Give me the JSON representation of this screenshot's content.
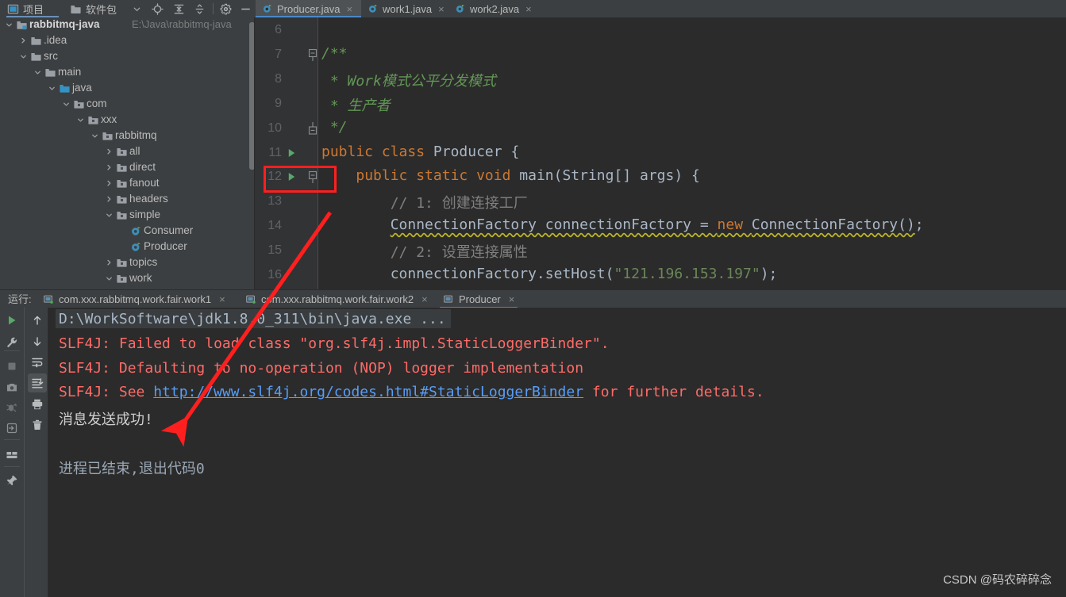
{
  "toolbar": {
    "project_label": "项目",
    "package_label": "软件包",
    "buttons": [
      "chevron-down-icon",
      "locate-target-icon",
      "expand-all-icon",
      "collapse-all-icon",
      "gear-icon",
      "minimize-icon"
    ]
  },
  "editor_tabs": [
    {
      "label": "Producer.java",
      "close": "×",
      "active": true
    },
    {
      "label": "work1.java",
      "close": "×",
      "active": false
    },
    {
      "label": "work2.java",
      "close": "×",
      "active": false
    }
  ],
  "project_tree": {
    "root_path": "E:\\Java\\rabbitmq-java",
    "rows": [
      {
        "label": "rabbitmq-java",
        "level": 0,
        "arrow": "down",
        "icon": "module",
        "bold": true
      },
      {
        "label": ".idea",
        "level": 1,
        "arrow": "right",
        "icon": "folder"
      },
      {
        "label": "src",
        "level": 1,
        "arrow": "down",
        "icon": "folder"
      },
      {
        "label": "main",
        "level": 2,
        "arrow": "down",
        "icon": "folder"
      },
      {
        "label": "java",
        "level": 3,
        "arrow": "down",
        "icon": "source-folder"
      },
      {
        "label": "com",
        "level": 4,
        "arrow": "down",
        "icon": "package"
      },
      {
        "label": "xxx",
        "level": 5,
        "arrow": "down",
        "icon": "package"
      },
      {
        "label": "rabbitmq",
        "level": 6,
        "arrow": "down",
        "icon": "package"
      },
      {
        "label": "all",
        "level": 7,
        "arrow": "right",
        "icon": "package"
      },
      {
        "label": "direct",
        "level": 7,
        "arrow": "right",
        "icon": "package"
      },
      {
        "label": "fanout",
        "level": 7,
        "arrow": "right",
        "icon": "package"
      },
      {
        "label": "headers",
        "level": 7,
        "arrow": "right",
        "icon": "package"
      },
      {
        "label": "simple",
        "level": 7,
        "arrow": "down",
        "icon": "package"
      },
      {
        "label": "Consumer",
        "level": 8,
        "arrow": "none",
        "icon": "java-class"
      },
      {
        "label": "Producer",
        "level": 8,
        "arrow": "none",
        "icon": "java-class"
      },
      {
        "label": "topics",
        "level": 7,
        "arrow": "right",
        "icon": "package"
      },
      {
        "label": "work",
        "level": 7,
        "arrow": "down",
        "icon": "package"
      }
    ]
  },
  "code": {
    "lines": [
      {
        "num": "6",
        "run": false,
        "fold": "none",
        "tokens": []
      },
      {
        "num": "7",
        "run": false,
        "fold": "start",
        "tokens": [
          {
            "t": "/**",
            "c": "j"
          }
        ]
      },
      {
        "num": "8",
        "run": false,
        "fold": "none",
        "tokens": [
          {
            "t": " * Work模式公平分发模式",
            "c": "j"
          }
        ]
      },
      {
        "num": "9",
        "run": false,
        "fold": "none",
        "tokens": [
          {
            "t": " * 生产者",
            "c": "j"
          }
        ]
      },
      {
        "num": "10",
        "run": false,
        "fold": "end",
        "tokens": [
          {
            "t": " */",
            "c": "j"
          }
        ]
      },
      {
        "num": "11",
        "run": true,
        "fold": "none",
        "tokens": [
          {
            "t": "public class ",
            "c": "k"
          },
          {
            "t": "Producer ",
            "c": "d"
          },
          {
            "t": "{",
            "c": "d"
          }
        ]
      },
      {
        "num": "12",
        "run": true,
        "fold": "mid",
        "tokens": [
          {
            "t": "    ",
            "c": "d"
          },
          {
            "t": "public static void ",
            "c": "k"
          },
          {
            "t": "main",
            "c": "d"
          },
          {
            "t": "(String[] args) {",
            "c": "d"
          }
        ]
      },
      {
        "num": "13",
        "run": false,
        "fold": "none",
        "tokens": [
          {
            "t": "        // 1: 创建连接工厂",
            "c": "c"
          }
        ]
      },
      {
        "num": "14",
        "run": false,
        "fold": "none",
        "tokens": [
          {
            "t": "        ",
            "c": "d"
          },
          {
            "t": "ConnectionFactory connectionFactory = ",
            "c": "d wavy"
          },
          {
            "t": "new ",
            "c": "k wavy"
          },
          {
            "t": "ConnectionFactory()",
            "c": "d wavy"
          },
          {
            "t": ";",
            "c": "d"
          }
        ]
      },
      {
        "num": "15",
        "run": false,
        "fold": "none",
        "tokens": [
          {
            "t": "        // 2: 设置连接属性",
            "c": "c"
          }
        ]
      },
      {
        "num": "16",
        "run": false,
        "fold": "none",
        "tokens": [
          {
            "t": "        connectionFactory.",
            "c": "d"
          },
          {
            "t": "setHost",
            "c": "d"
          },
          {
            "t": "(",
            "c": "d"
          },
          {
            "t": "\"121.196.153.197\"",
            "c": "s"
          },
          {
            "t": ");",
            "c": "d"
          }
        ]
      }
    ]
  },
  "run_panel": {
    "label": "运行:",
    "tabs": [
      {
        "label": "com.xxx.rabbitmq.work.fair.work1",
        "close": "×",
        "active": false
      },
      {
        "label": "com.xxx.rabbitmq.work.fair.work2",
        "close": "×",
        "active": false
      },
      {
        "label": "Producer",
        "close": "×",
        "active": true
      }
    ],
    "tools_left": [
      "rerun-icon",
      "settings-wrench-icon",
      "stop-icon",
      "camera-icon",
      "thread-dump-icon",
      "export-icon",
      "layout-icon",
      "pin-icon"
    ],
    "tools_right": [
      "up-arrow-icon",
      "down-arrow-icon",
      "soft-wrap-icon",
      "scroll-to-end-icon",
      "print-icon",
      "trash-icon"
    ],
    "console_lines": [
      {
        "cls": "co-gray",
        "tokens": [
          {
            "t": "D:\\WorkSoftware\\jdk1.8.0_311\\bin\\java.exe ...",
            "c": "co-gray"
          }
        ]
      },
      {
        "cls": "co-red",
        "tokens": [
          {
            "t": "SLF4J: Failed to load class \"org.slf4j.impl.StaticLoggerBinder\".",
            "c": "co-red"
          }
        ]
      },
      {
        "cls": "co-red",
        "tokens": [
          {
            "t": "SLF4J: Defaulting to no-operation (NOP) logger implementation",
            "c": "co-red"
          }
        ]
      },
      {
        "cls": "co-red",
        "tokens": [
          {
            "t": "SLF4J: See ",
            "c": "co-red"
          },
          {
            "t": "http://www.slf4j.org/codes.html#StaticLoggerBinder",
            "c": "co-link"
          },
          {
            "t": " for further details.",
            "c": "co-red"
          }
        ]
      },
      {
        "cls": "co-white",
        "tokens": [
          {
            "t": "消息发送成功!",
            "c": "co-white"
          }
        ]
      },
      {
        "cls": "co-exit",
        "tokens": [
          {
            "t": "",
            "c": "co-exit"
          }
        ]
      },
      {
        "cls": "co-exit",
        "tokens": [
          {
            "t": "进程已结束,退出代码0",
            "c": "co-exit"
          }
        ]
      }
    ]
  },
  "annotation": {
    "highlight_target": "gutter-line-12",
    "arrow_color": "#ff1f1f"
  },
  "watermark": "CSDN @码农碎碎念"
}
